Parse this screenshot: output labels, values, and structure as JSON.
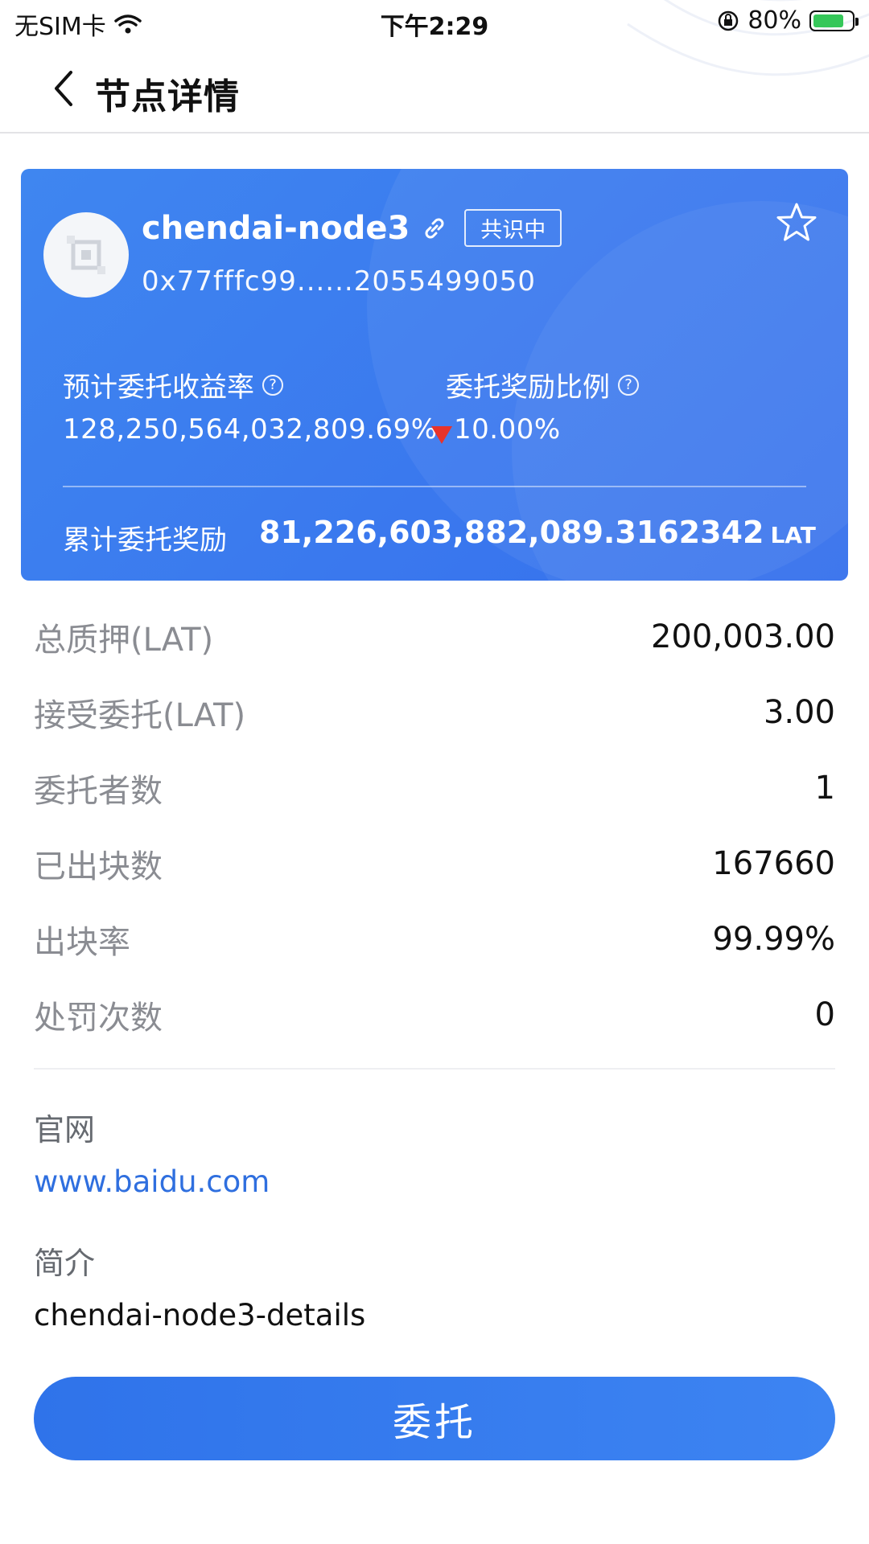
{
  "status_bar": {
    "carrier": "无SIM卡",
    "time": "下午2:29",
    "battery": "80%",
    "battery_level": 0.8
  },
  "header": {
    "title": "节点详情"
  },
  "node": {
    "name": "chendai-node3",
    "status_badge": "共识中",
    "address": "0x77fffc99......2055499050",
    "expected_yield_label": "预计委托收益率",
    "expected_yield_value": "128,250,564,032,809.69%",
    "reward_ratio_label": "委托奖励比例",
    "reward_ratio_value": "10.00%",
    "cumulative_reward_label": "累计委托奖励",
    "cumulative_reward_value": "81,226,603,882,089.3162342",
    "cumulative_reward_unit": "LAT"
  },
  "stats": [
    {
      "label": "总质押(LAT)",
      "value": "200,003.00"
    },
    {
      "label": "接受委托(LAT)",
      "value": "3.00"
    },
    {
      "label": "委托者数",
      "value": "1"
    },
    {
      "label": "已出块数",
      "value": "167660"
    },
    {
      "label": "出块率",
      "value": "99.99%"
    },
    {
      "label": "处罚次数",
      "value": "0"
    }
  ],
  "website": {
    "label": "官网",
    "url": "www.baidu.com"
  },
  "intro": {
    "label": "简介",
    "text": "chendai-node3-details"
  },
  "actions": {
    "delegate": "委托"
  },
  "colors": {
    "card_blue": "#3a78ee",
    "link_blue": "#2f6fdf",
    "badge_battery": "#35c759",
    "down_arrow": "#e8332b"
  }
}
